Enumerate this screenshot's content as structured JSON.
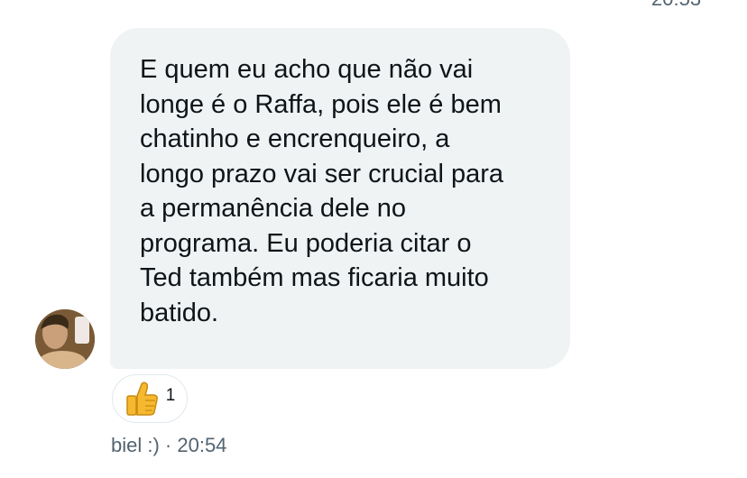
{
  "chat": {
    "top_timestamp": "20:53",
    "message": {
      "text": "E quem eu acho que não vai\nlonge é o Raffa, pois ele é bem\nchatinho e encrenqueiro, a\nlongo prazo vai ser crucial para\na permanência dele no\nprograma. Eu poderia citar o\nTed também mas ficaria muito\nbatido.",
      "sender": "biel :)",
      "separator": " · ",
      "time": "20:54"
    },
    "reaction": {
      "icon": "thumbs-up-icon",
      "count": "1"
    }
  }
}
